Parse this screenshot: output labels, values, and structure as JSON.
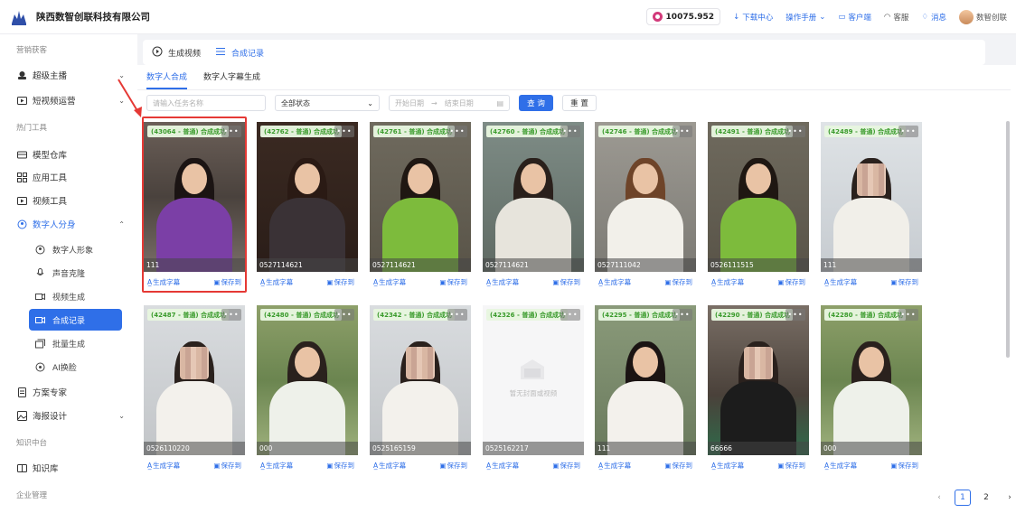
{
  "header": {
    "company": "陕西数智创联科技有限公司",
    "balance": "10075.952",
    "links": [
      "下载中心",
      "操作手册",
      "客户端",
      "客服",
      "消息"
    ],
    "user": "数智创联"
  },
  "sidebar": {
    "sections": [
      "营销获客",
      "热门工具",
      "知识中台",
      "企业管理"
    ],
    "items": [
      {
        "label": "超级主播",
        "icon": "anchor-icon",
        "chevron": "⌄"
      },
      {
        "label": "短视频运营",
        "icon": "video-box-icon",
        "chevron": "⌄"
      },
      {
        "label": "模型仓库",
        "icon": "warehouse-icon"
      },
      {
        "label": "应用工具",
        "icon": "apps-icon"
      },
      {
        "label": "视频工具",
        "icon": "video-tool-icon"
      },
      {
        "label": "数字人分身",
        "icon": "digital-human-icon",
        "chevron": "⌃"
      },
      {
        "label": "方案专家",
        "icon": "document-icon"
      },
      {
        "label": "海报设计",
        "icon": "poster-icon",
        "chevron": "⌄"
      },
      {
        "label": "知识库",
        "icon": "book-icon"
      }
    ],
    "sub_items": [
      {
        "label": "数字人形象",
        "icon": "avatar-icon"
      },
      {
        "label": "声音克隆",
        "icon": "mic-icon"
      },
      {
        "label": "视频生成",
        "icon": "video-icon"
      },
      {
        "label": "合成记录",
        "icon": "record-icon"
      },
      {
        "label": "批量生成",
        "icon": "batch-icon"
      },
      {
        "label": "AI换脸",
        "icon": "face-swap-icon"
      }
    ]
  },
  "topbar": {
    "tabs": [
      "生成视频",
      "合成记录"
    ]
  },
  "subtabs": [
    "数字人合成",
    "数字人字幕生成"
  ],
  "filters": {
    "search_placeholder": "请输入任务名称",
    "status": "全部状态",
    "start_date": "开始日期",
    "end_date": "结束日期",
    "search_btn": "查 询",
    "reset_btn": "重 置"
  },
  "card_actions": {
    "subtitle": "生成字幕",
    "save": "保存到"
  },
  "more": "•••",
  "empty_text": "暂无封面或视频",
  "cards": [
    {
      "badge": "(43064 - 普通)  合成成功",
      "caption": "111"
    },
    {
      "badge": "(42762 - 普通)  合成成功",
      "caption": "0527114621"
    },
    {
      "badge": "(42761 - 普通)  合成成功",
      "caption": "0527114621"
    },
    {
      "badge": "(42760 - 普通)  合成成功",
      "caption": "0527114621"
    },
    {
      "badge": "(42746 - 普通)  合成成功",
      "caption": "0527111042"
    },
    {
      "badge": "(42491 - 普通)  合成成功",
      "caption": "0526111515"
    },
    {
      "badge": "(42489 - 普通)  合成成功",
      "caption": "111"
    },
    {
      "badge": "(42487 - 普通)  合成成功",
      "caption": "0526110220"
    },
    {
      "badge": "(42480 - 普通)  合成成功",
      "caption": "000"
    },
    {
      "badge": "(42342 - 普通)  合成成功",
      "caption": "0525165159"
    },
    {
      "badge": "(42326 - 普通)  合成成功",
      "caption": "0525162217"
    },
    {
      "badge": "(42295 - 普通)  合成成功",
      "caption": "111"
    },
    {
      "badge": "(42290 - 普通)  合成成功",
      "caption": "66666"
    },
    {
      "badge": "(42280 - 普通)  合成成功",
      "caption": "000"
    }
  ],
  "pagination": {
    "pages": [
      "1",
      "2"
    ],
    "current": "1"
  }
}
